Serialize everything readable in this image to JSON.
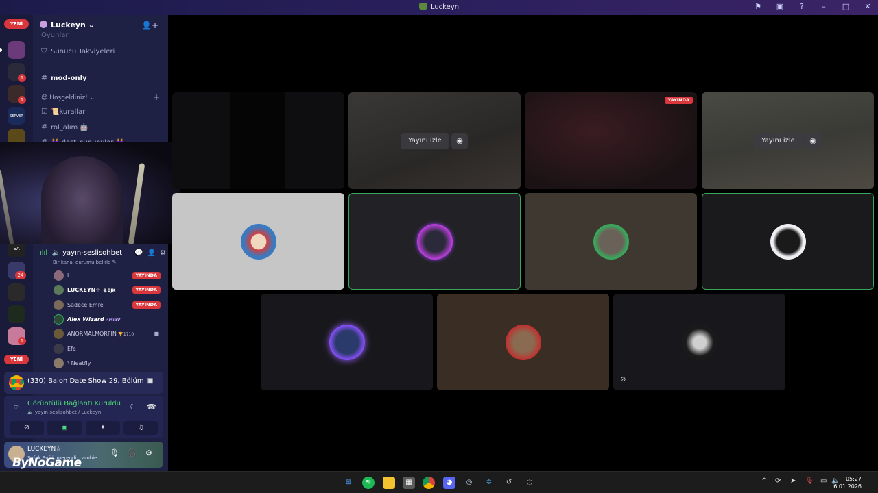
{
  "window": {
    "title": "Luckeyn",
    "controls": [
      "inbox-icon",
      "screen-icon",
      "help-icon",
      "minimize",
      "maximize",
      "close"
    ]
  },
  "servers": {
    "new_badge_top": "YENİ",
    "new_badge_bottom": "YENİ",
    "items": [
      {
        "label": "",
        "count": ""
      },
      {
        "label": "",
        "count": "1"
      },
      {
        "label": "",
        "count": "1"
      },
      {
        "label": "SERVER HANE",
        "count": ""
      },
      {
        "label": "",
        "count": ""
      },
      {
        "label": "EA",
        "count": ""
      },
      {
        "label": "",
        "count": "24"
      },
      {
        "label": "",
        "count": ""
      },
      {
        "label": "",
        "count": ""
      },
      {
        "label": "",
        "count": "1"
      }
    ]
  },
  "sidebar": {
    "server_name": "Luckeyn",
    "partial_top": "Oyunlar",
    "boosts": "Sunucu Takviyeleri",
    "channel_mod": "mod-only",
    "category": "😊 Hoşgeldiniz!",
    "channels": [
      "📜kurallar",
      "rol_alım 🤖",
      "👭 dost_sunucular 👭"
    ],
    "voice_channel": "yayın-seslisohbet",
    "voice_status": "Bir kanal durumu belirle",
    "users": [
      {
        "name": "l...",
        "tag": "",
        "live": "YAYINDA"
      },
      {
        "name": "LUCKEYN☆",
        "tag": "🐇BJK",
        "live": "YAYINDA"
      },
      {
        "name": "Sadece Emre",
        "tag": "",
        "live": "YAYINDA"
      },
      {
        "name": "Alex Wizard",
        "tag": "⚡MiaV",
        "live": ""
      },
      {
        "name": "ANORMALMORFIN",
        "tag": "🏆1710",
        "live": ""
      },
      {
        "name": "Efe",
        "tag": "",
        "live": ""
      },
      {
        "name": "ᵀ Neatfly",
        "tag": "",
        "live": ""
      }
    ]
  },
  "activity": {
    "title": "(330) Balon Date Show 29. Bölüm ..."
  },
  "voice_connection": {
    "status": "Görüntülü Bağlantı Kuruldu",
    "channel": "🔈 yayın-seslisohbet / Luckeyn"
  },
  "user_panel": {
    "name": "LUCKEYN☆",
    "status": "Şafak Sufri, merendi, cambie",
    "watermark": "ByNoGame"
  },
  "grid": {
    "watch_label": "Yayını izle",
    "live_label": "YAYINDA"
  },
  "taskbar": {
    "clock_time": "05:27",
    "clock_date": "6.01.2026"
  }
}
